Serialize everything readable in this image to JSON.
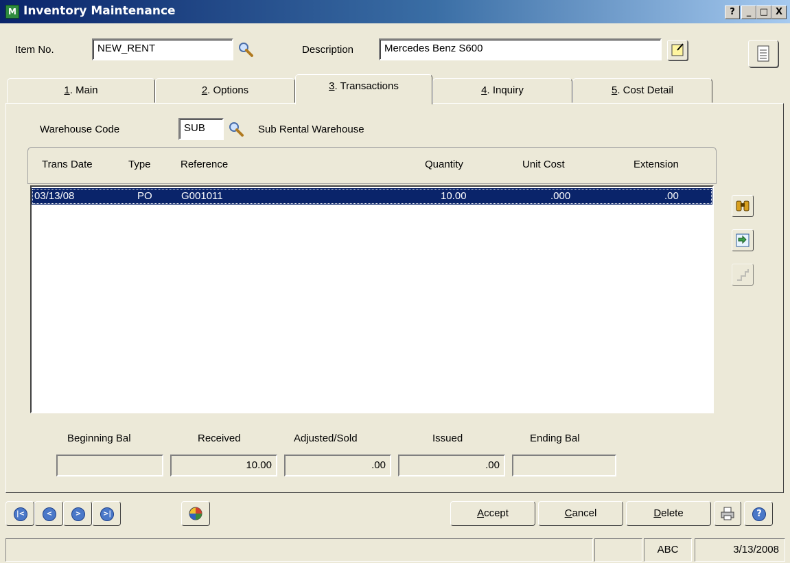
{
  "window": {
    "title": "Inventory Maintenance",
    "app_icon_text": "M",
    "controls": [
      "?",
      "_",
      "□",
      "X"
    ]
  },
  "header": {
    "item_no_label": "Item No.",
    "item_no_value": "NEW_RENT",
    "description_label": "Description",
    "description_value": "Mercedes Benz S600"
  },
  "tabs": [
    {
      "num": "1",
      "label": ". Main"
    },
    {
      "num": "2",
      "label": ". Options"
    },
    {
      "num": "3",
      "label": ". Transactions"
    },
    {
      "num": "4",
      "label": ". Inquiry"
    },
    {
      "num": "5",
      "label": ". Cost Detail"
    }
  ],
  "active_tab": "3. Transactions",
  "warehouse": {
    "label": "Warehouse Code",
    "code": "SUB",
    "name": "Sub Rental Warehouse"
  },
  "grid": {
    "columns": [
      "Trans Date",
      "Type",
      "Reference",
      "Quantity",
      "Unit Cost",
      "Extension"
    ],
    "rows": [
      {
        "date": "03/13/08",
        "type": "PO",
        "reference": "G001011",
        "quantity": "10.00",
        "unit_cost": ".000",
        "extension": ".00"
      }
    ]
  },
  "totals": {
    "beginning_bal_label": "Beginning Bal",
    "beginning_bal": "",
    "received_label": "Received",
    "received": "10.00",
    "adjusted_label": "Adjusted/Sold",
    "adjusted": ".00",
    "issued_label": "Issued",
    "issued": ".00",
    "ending_bal_label": "Ending Bal",
    "ending_bal": ""
  },
  "buttons": {
    "accept_first": "A",
    "accept_rest": "ccept",
    "cancel_first": "C",
    "cancel_rest": "ancel",
    "delete_first": "D",
    "delete_rest": "elete"
  },
  "status": {
    "message": "",
    "mode": "ABC",
    "date": "3/13/2008"
  },
  "colors": {
    "selection": "#0a246a",
    "face": "#ece9d8"
  }
}
